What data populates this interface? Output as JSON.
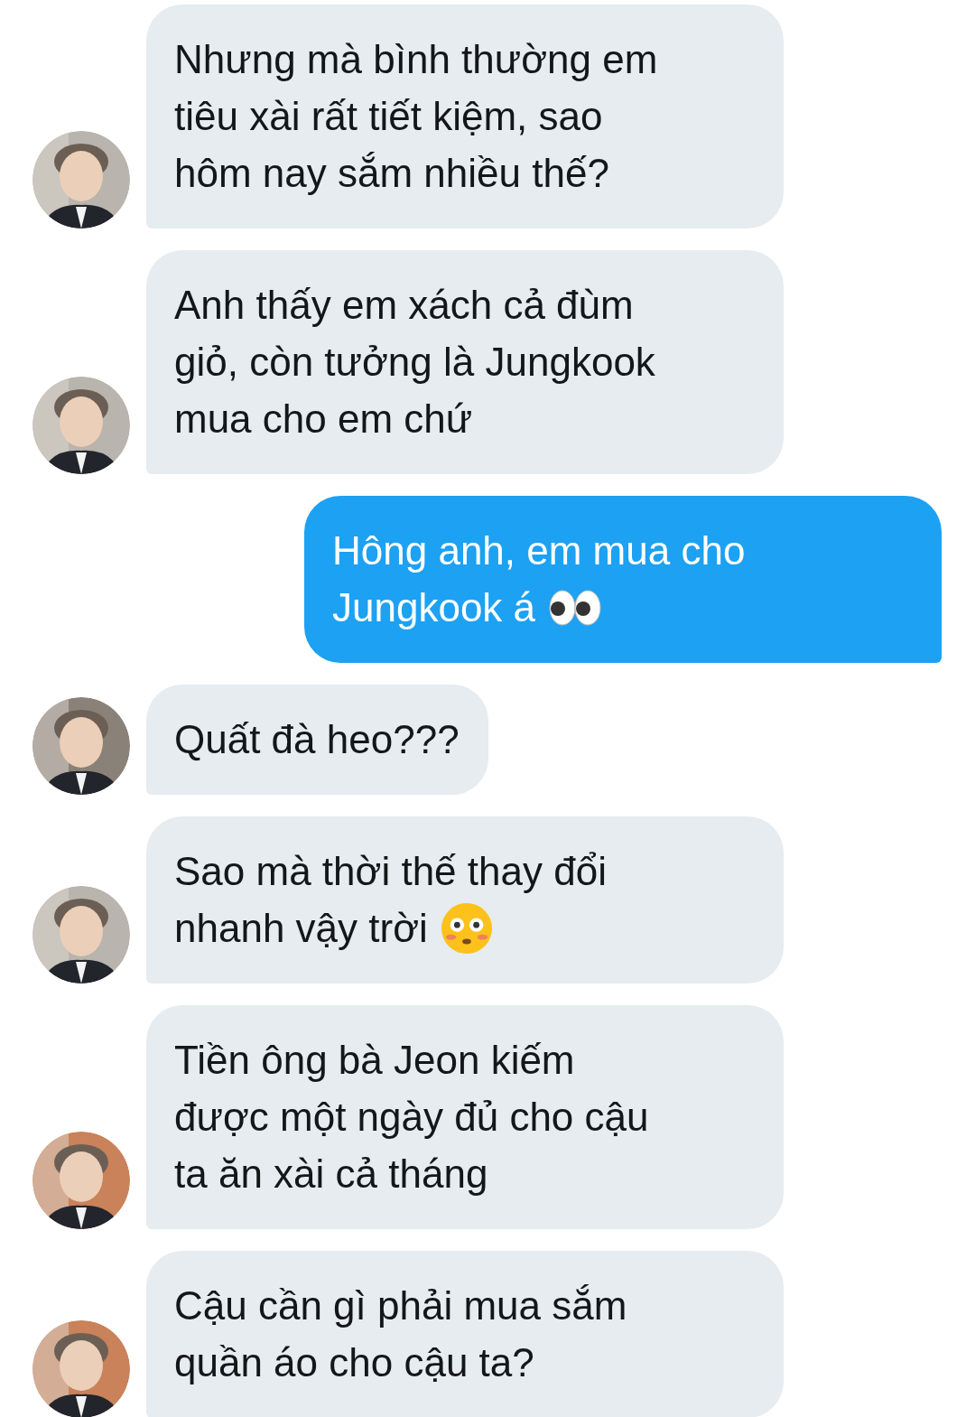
{
  "messages": [
    {
      "kind": "incoming",
      "avatar": {
        "kind": "picture",
        "color": "#b9b4ad"
      },
      "lines": [
        "Nhưng mà bình thường em",
        "tiêu xài rất tiết kiệm, sao",
        "hôm nay sắm nhiều thế?"
      ]
    },
    {
      "kind": "incoming",
      "avatar": {
        "kind": "picture",
        "color": "#b9b4ad"
      },
      "lines": [
        "Anh thấy em xách cả đùm",
        "giỏ, còn tưởng là Jungkook",
        "mua cho em chứ"
      ]
    },
    {
      "kind": "outgoing",
      "lines": [
        "Hông anh, em mua cho",
        "Jungkook á"
      ],
      "emoji": {
        "kind": "eyes"
      }
    },
    {
      "kind": "incoming",
      "avatar": {
        "kind": "picture",
        "color": "#8a8178"
      },
      "lines": [
        "Quất đà heo???"
      ]
    },
    {
      "kind": "incoming",
      "avatar": {
        "kind": "picture",
        "color": "#b9b4ad"
      },
      "lines": [
        "Sao mà thời thế thay đổi",
        "nhanh vậy trời"
      ],
      "emoji": {
        "kind": "flushed"
      }
    },
    {
      "kind": "incoming",
      "avatar": {
        "kind": "picture",
        "color": "#c9825a"
      },
      "lines": [
        "Tiền ông bà Jeon kiếm",
        "được một ngày đủ cho cậu",
        "ta ăn xài cả tháng"
      ]
    },
    {
      "kind": "incoming",
      "avatar": {
        "kind": "picture",
        "color": "#c9825a"
      },
      "lines": [
        "Cậu cần gì phải mua sắm",
        "quần áo cho cậu ta?"
      ]
    }
  ]
}
